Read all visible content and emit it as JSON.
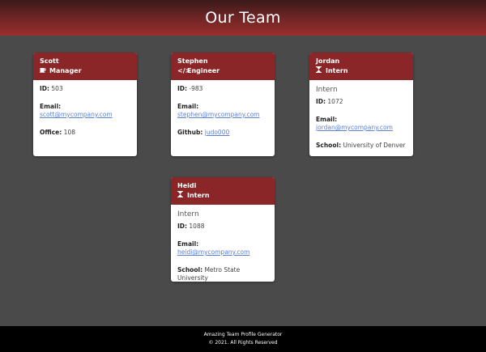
{
  "header": {
    "title": "Our Team"
  },
  "cards": {
    "scott": {
      "name": "Scott",
      "role": "Manager",
      "id_label": "ID:",
      "id_value": "503",
      "email_label": "Email:",
      "email_value": "scott@mycompany.com",
      "extra_label": "Office:",
      "extra_value": "108"
    },
    "stephen": {
      "name": "Stephen",
      "role": "Engineer",
      "id_label": "ID:",
      "id_value": "-983",
      "email_label": "Email:",
      "email_value": "stephen@mycompany.com",
      "extra_label": "Github:",
      "extra_value": "judo000"
    },
    "jordan": {
      "name": "Jordan",
      "role": "Intern",
      "subtitle": "Intern",
      "id_label": "ID:",
      "id_value": "1072",
      "email_label": "Email:",
      "email_value": "jordan@mycompany.com",
      "extra_label": "School:",
      "extra_value": "University of Denver"
    },
    "heidi": {
      "name": "Heidi",
      "role": "Intern",
      "subtitle": "Intern",
      "id_label": "ID:",
      "id_value": "1088",
      "email_label": "Email:",
      "email_value": "heidi@mycompany.com",
      "extra_label": "School:",
      "extra_value": "Metro State University"
    }
  },
  "footer": {
    "line1": "Amazing Team Profile Generator",
    "line2": "© 2021. All Rights Reserved"
  },
  "colors": {
    "header_accent": "#8b2628",
    "card_head": "#8b2628",
    "link": "#5a7fd6",
    "background": "#4b4a4a"
  },
  "icons": {
    "manager": "coffee-mug-icon",
    "engineer": "code-brackets-icon",
    "intern": "hourglass-icon"
  }
}
